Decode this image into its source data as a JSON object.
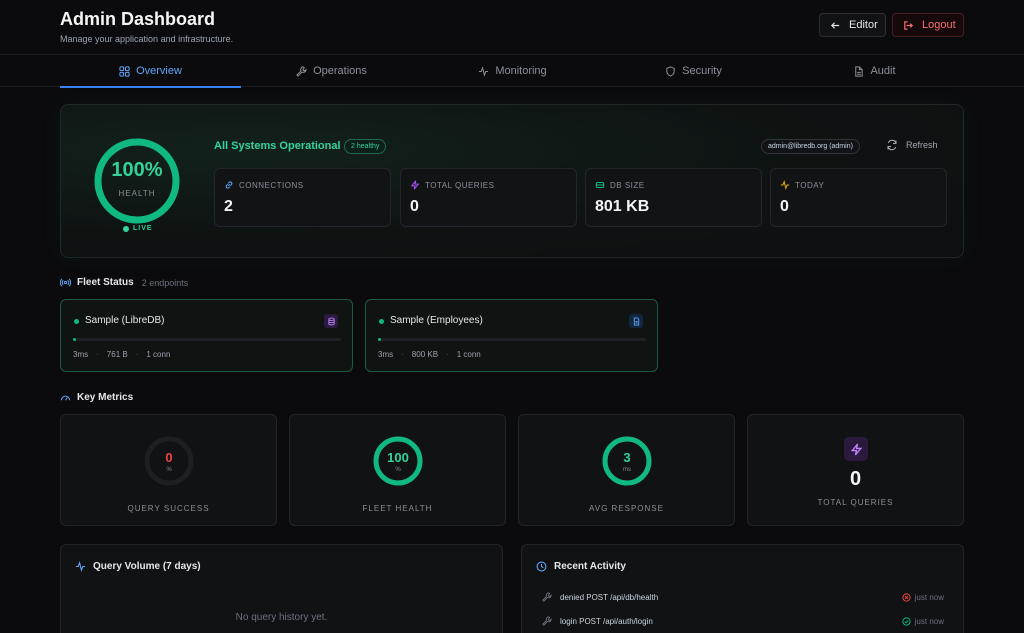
{
  "header": {
    "title": "Admin Dashboard",
    "subtitle": "Manage your application and infrastructure.",
    "editor_label": "Editor",
    "logout_label": "Logout"
  },
  "tabs": [
    {
      "label": "Overview",
      "icon": "grid-icon",
      "active": true
    },
    {
      "label": "Operations",
      "icon": "wrench-icon"
    },
    {
      "label": "Monitoring",
      "icon": "activity-icon"
    },
    {
      "label": "Security",
      "icon": "shield-icon"
    },
    {
      "label": "Audit",
      "icon": "document-icon"
    }
  ],
  "health": {
    "percent": "100%",
    "percent_value": 100,
    "label": "HEALTH",
    "live_label": "LIVE",
    "status": "All Systems Operational",
    "badge": "2 healthy",
    "user": "admin@libredb.org (admin)",
    "refresh_label": "Refresh",
    "stats": [
      {
        "label": "CONNECTIONS",
        "value": "2",
        "icon": "link-icon"
      },
      {
        "label": "TOTAL QUERIES",
        "value": "0",
        "icon": "bolt-icon"
      },
      {
        "label": "DB SIZE",
        "value": "801 KB",
        "icon": "drive-icon"
      },
      {
        "label": "TODAY",
        "value": "0",
        "icon": "activity-icon"
      }
    ]
  },
  "fleet": {
    "title": "Fleet Status",
    "subtitle": "2 endpoints",
    "items": [
      {
        "name": "Sample (LibreDB)",
        "latency": "3ms",
        "size": "761 B",
        "conns": "1 conn",
        "usage": 0.01,
        "icon": "database-icon"
      },
      {
        "name": "Sample (Employees)",
        "latency": "3ms",
        "size": "800 KB",
        "conns": "1 conn",
        "usage": 0.01,
        "icon": "file-icon"
      }
    ]
  },
  "metrics": {
    "title": "Key Metrics",
    "items": [
      {
        "value": "0",
        "unit": "%",
        "label": "QUERY SUCCESS",
        "fraction": 0,
        "color": "#ef4444"
      },
      {
        "value": "100",
        "unit": "%",
        "label": "FLEET HEALTH",
        "fraction": 1,
        "color": "#10b981"
      },
      {
        "value": "3",
        "unit": "ms",
        "label": "AVG RESPONSE",
        "fraction": 1,
        "color": "#10b981"
      },
      {
        "value": "0",
        "label": "TOTAL QUERIES",
        "icon": "bolt-icon"
      }
    ]
  },
  "query_volume": {
    "title": "Query Volume (7 days)",
    "empty": "No query history yet."
  },
  "activity": {
    "title": "Recent Activity",
    "items": [
      {
        "text": "denied POST /api/db/health",
        "time": "just now",
        "status": "denied"
      },
      {
        "text": "login POST /api/auth/login",
        "time": "just now",
        "status": "success"
      }
    ]
  },
  "colors": {
    "accent": "#3b82f6",
    "success": "#10b981",
    "danger": "#ef4444",
    "warning": "#eab308",
    "purple": "#a855f7"
  }
}
